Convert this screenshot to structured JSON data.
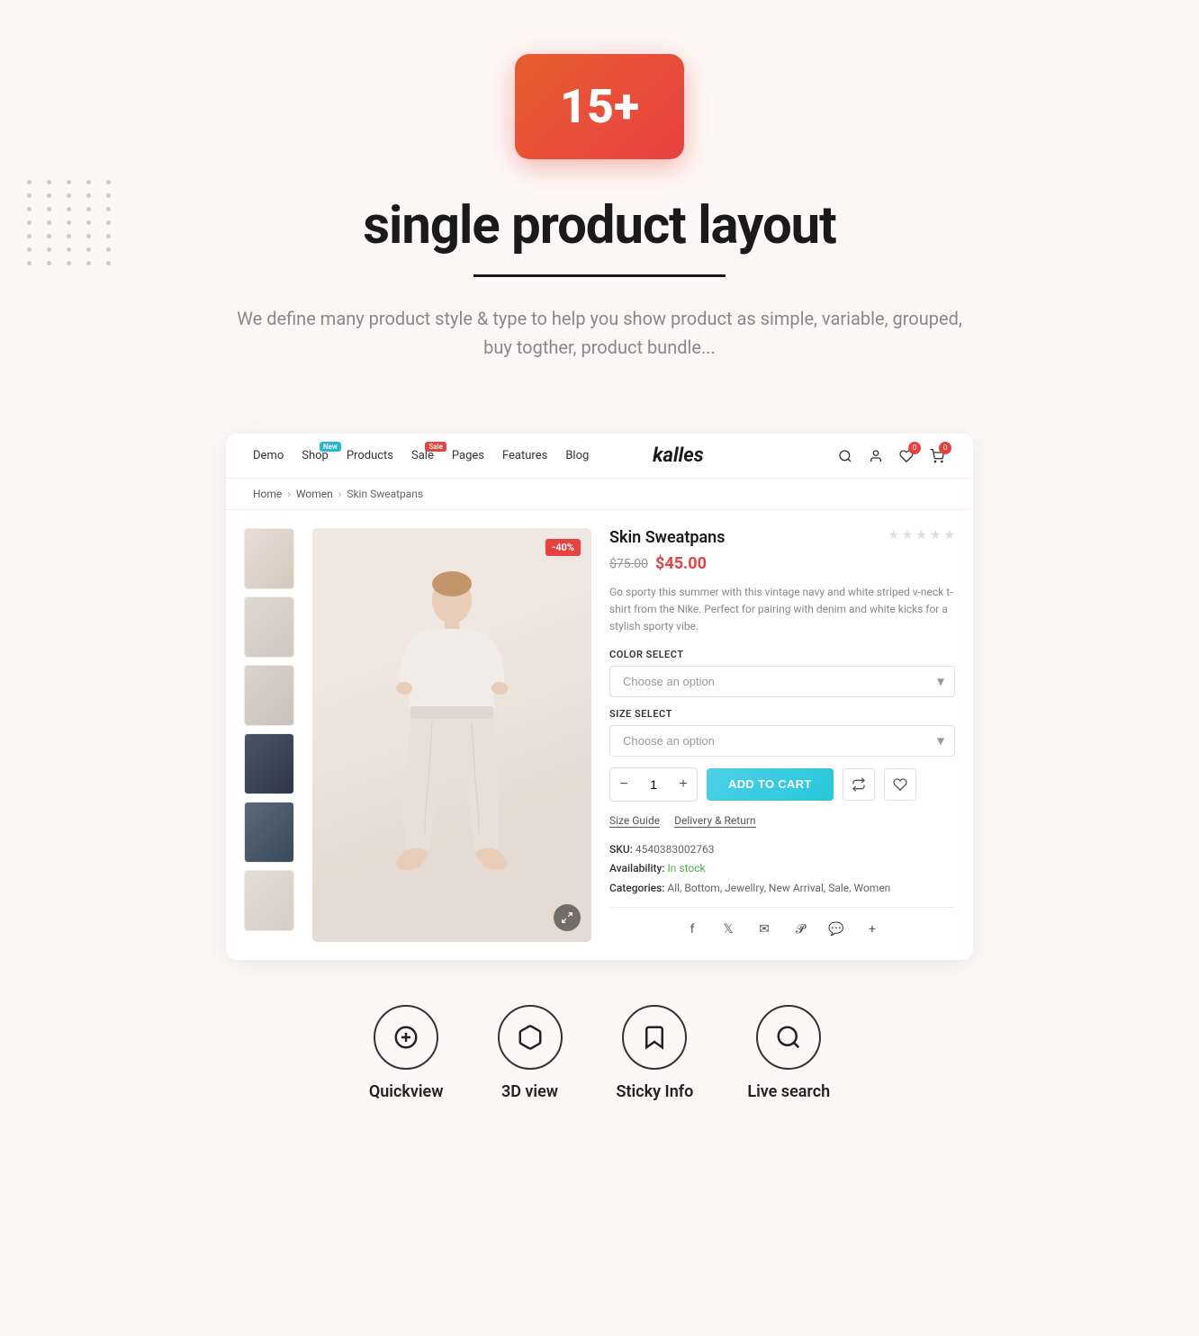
{
  "hero": {
    "badge": "15+",
    "title": "single product layout",
    "description": "We define many product style & type to help you show product as simple, variable, grouped, buy togther, product bundle..."
  },
  "navbar": {
    "links": [
      {
        "label": "Demo",
        "badge": null
      },
      {
        "label": "Shop",
        "badge": "New"
      },
      {
        "label": "Products",
        "badge": null
      },
      {
        "label": "Sale",
        "badge": "Sale"
      },
      {
        "label": "Pages",
        "badge": null
      },
      {
        "label": "Features",
        "badge": null
      },
      {
        "label": "Blog",
        "badge": null
      }
    ],
    "logo": "kalles",
    "cart_count": "0",
    "wishlist_count": "0"
  },
  "breadcrumb": {
    "items": [
      "Home",
      "Women",
      "Skin Sweatpans"
    ]
  },
  "product": {
    "name": "Skin Sweatpans",
    "price_old": "$75.00",
    "price_new": "$45.00",
    "discount": "-40%",
    "description": "Go sporty this summer with this vintage navy and white striped v-neck t-shirt from the Nike. Perfect for pairing with denim and white kicks for a stylish sporty vibe.",
    "color_label": "COLOR SELECT",
    "color_placeholder": "Choose an option",
    "size_label": "SIZE SELECT",
    "size_placeholder": "Choose an option",
    "quantity": "1",
    "add_to_cart": "ADD TO CART",
    "meta_links": [
      "Size Guide",
      "Delivery & Return"
    ],
    "sku_label": "SKU:",
    "sku_value": "4540383002763",
    "availability_label": "Availability:",
    "availability_value": "In stock",
    "categories_label": "Categories:",
    "categories_value": "All, Bottom, Jewellry, New Arrival, Sale, Women"
  },
  "features": [
    {
      "icon": "➕",
      "label": "Quickview",
      "name": "quickview"
    },
    {
      "icon": "📦",
      "label": "3D view",
      "name": "3d-view"
    },
    {
      "icon": "🔖",
      "label": "Sticky Info",
      "name": "sticky-info"
    },
    {
      "icon": "🔍",
      "label": "Live search",
      "name": "live-search"
    }
  ]
}
